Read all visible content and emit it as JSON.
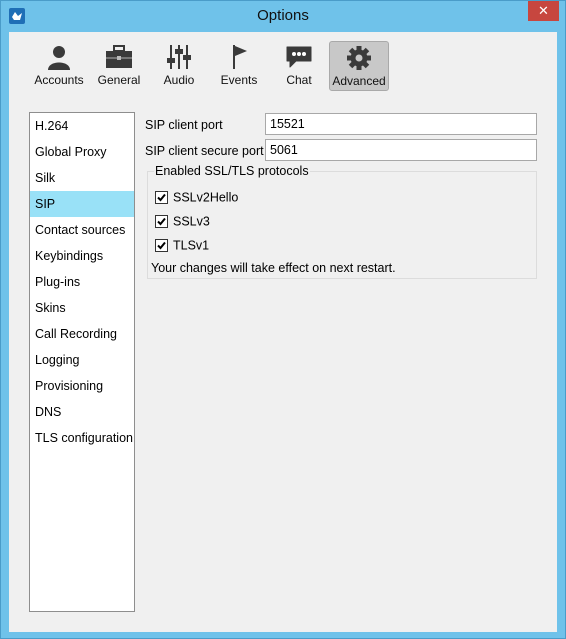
{
  "window": {
    "title": "Options",
    "close_label": "✕"
  },
  "toolbar": {
    "items": [
      {
        "label": "Accounts",
        "icon": "user-icon"
      },
      {
        "label": "General",
        "icon": "briefcase-icon"
      },
      {
        "label": "Audio",
        "icon": "mixer-sliders-icon"
      },
      {
        "label": "Events",
        "icon": "flag-icon"
      },
      {
        "label": "Chat",
        "icon": "chat-bubble-icon"
      },
      {
        "label": "Advanced",
        "icon": "gear-icon",
        "active": true
      }
    ]
  },
  "sidebar": {
    "items": [
      {
        "label": "H.264"
      },
      {
        "label": "Global Proxy"
      },
      {
        "label": "Silk"
      },
      {
        "label": "SIP",
        "selected": true
      },
      {
        "label": "Contact sources"
      },
      {
        "label": "Keybindings"
      },
      {
        "label": "Plug-ins"
      },
      {
        "label": "Skins"
      },
      {
        "label": "Call Recording"
      },
      {
        "label": "Logging"
      },
      {
        "label": "Provisioning"
      },
      {
        "label": "DNS"
      },
      {
        "label": "TLS configuration"
      }
    ]
  },
  "sip": {
    "client_port_label": "SIP client port",
    "client_port_value": "15521",
    "secure_port_label": "SIP client secure port",
    "secure_port_value": "5061",
    "protocols_group_title": "Enabled SSL/TLS protocols",
    "protocols": [
      {
        "label": "SSLv2Hello",
        "checked": true
      },
      {
        "label": "SSLv3",
        "checked": true
      },
      {
        "label": "TLSv1",
        "checked": true
      }
    ],
    "restart_note": "Your changes will take effect on next restart."
  },
  "colors": {
    "frame": "#6fc2ea",
    "selected_item": "#99e1f7",
    "close_button": "#c7463f",
    "active_tool": "#c8c8c8"
  }
}
